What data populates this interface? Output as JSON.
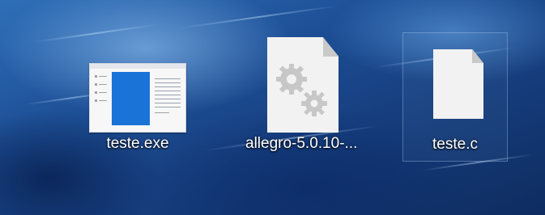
{
  "desktop": {
    "icons": [
      {
        "name": "teste.exe",
        "type": "exe-icon",
        "selected": false
      },
      {
        "name": "allegro-5.0.10-...",
        "type": "gears-file-icon",
        "selected": false
      },
      {
        "name": "teste.c",
        "type": "blank-file-icon",
        "selected": true
      }
    ]
  },
  "colors": {
    "wallpaper": "#1d4f96",
    "window_blue": "#1a73d6",
    "label_text": "#ffffff"
  }
}
